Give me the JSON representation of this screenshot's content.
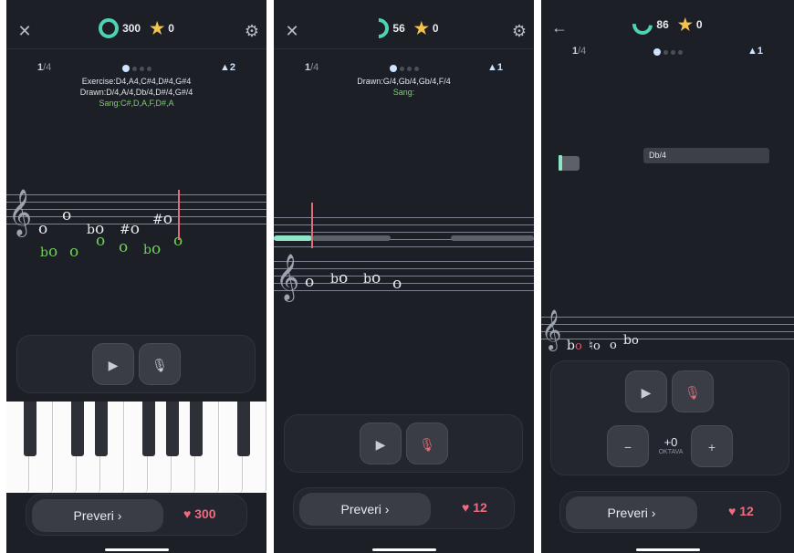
{
  "screens": [
    {
      "left_icon": "close-icon",
      "left_glyph": "✕",
      "streak": "300",
      "stars": "0",
      "pager_current": "1",
      "pager_total": "/4",
      "level": "2",
      "exercise": "Exercise:D4,A4,C#4,D#4,G#4",
      "drawn": "Drawn:D/4,A/4,Db/4,D#/4,G#/4",
      "sang": "Sang:C#,D,A,F,D#,A",
      "check_label": "Preveri ›",
      "hearts": "300"
    },
    {
      "left_icon": "close-icon",
      "left_glyph": "✕",
      "streak": "56",
      "stars": "0",
      "pager_current": "1",
      "pager_total": "/4",
      "level": "1",
      "drawn": "Drawn:G/4,Gb/4,Gb/4,F/4",
      "sang": "Sang:",
      "check_label": "Preveri ›",
      "hearts": "12"
    },
    {
      "left_icon": "back-arrow-icon",
      "left_glyph": "←",
      "streak": "86",
      "stars": "0",
      "pager_current": "1",
      "pager_total": "/4",
      "level": "1",
      "note_tag": "Db/4",
      "octave_value": "+0",
      "octave_label": "OKTAVA",
      "minus": "−",
      "plus": "+",
      "check_label": "Preveri ›",
      "hearts": "12"
    }
  ],
  "colors": {
    "accent": "#4fd1b4",
    "star": "#f5c24a",
    "heart": "#f06a80",
    "sang": "#7ad36a",
    "playhead": "#e06b7a"
  },
  "icons": [
    "close-icon",
    "back-arrow-icon",
    "gear-icon",
    "streak-ring-icon",
    "star-icon",
    "level-icon",
    "play-icon",
    "mic-icon",
    "heart-icon",
    "treble-clef-icon"
  ]
}
